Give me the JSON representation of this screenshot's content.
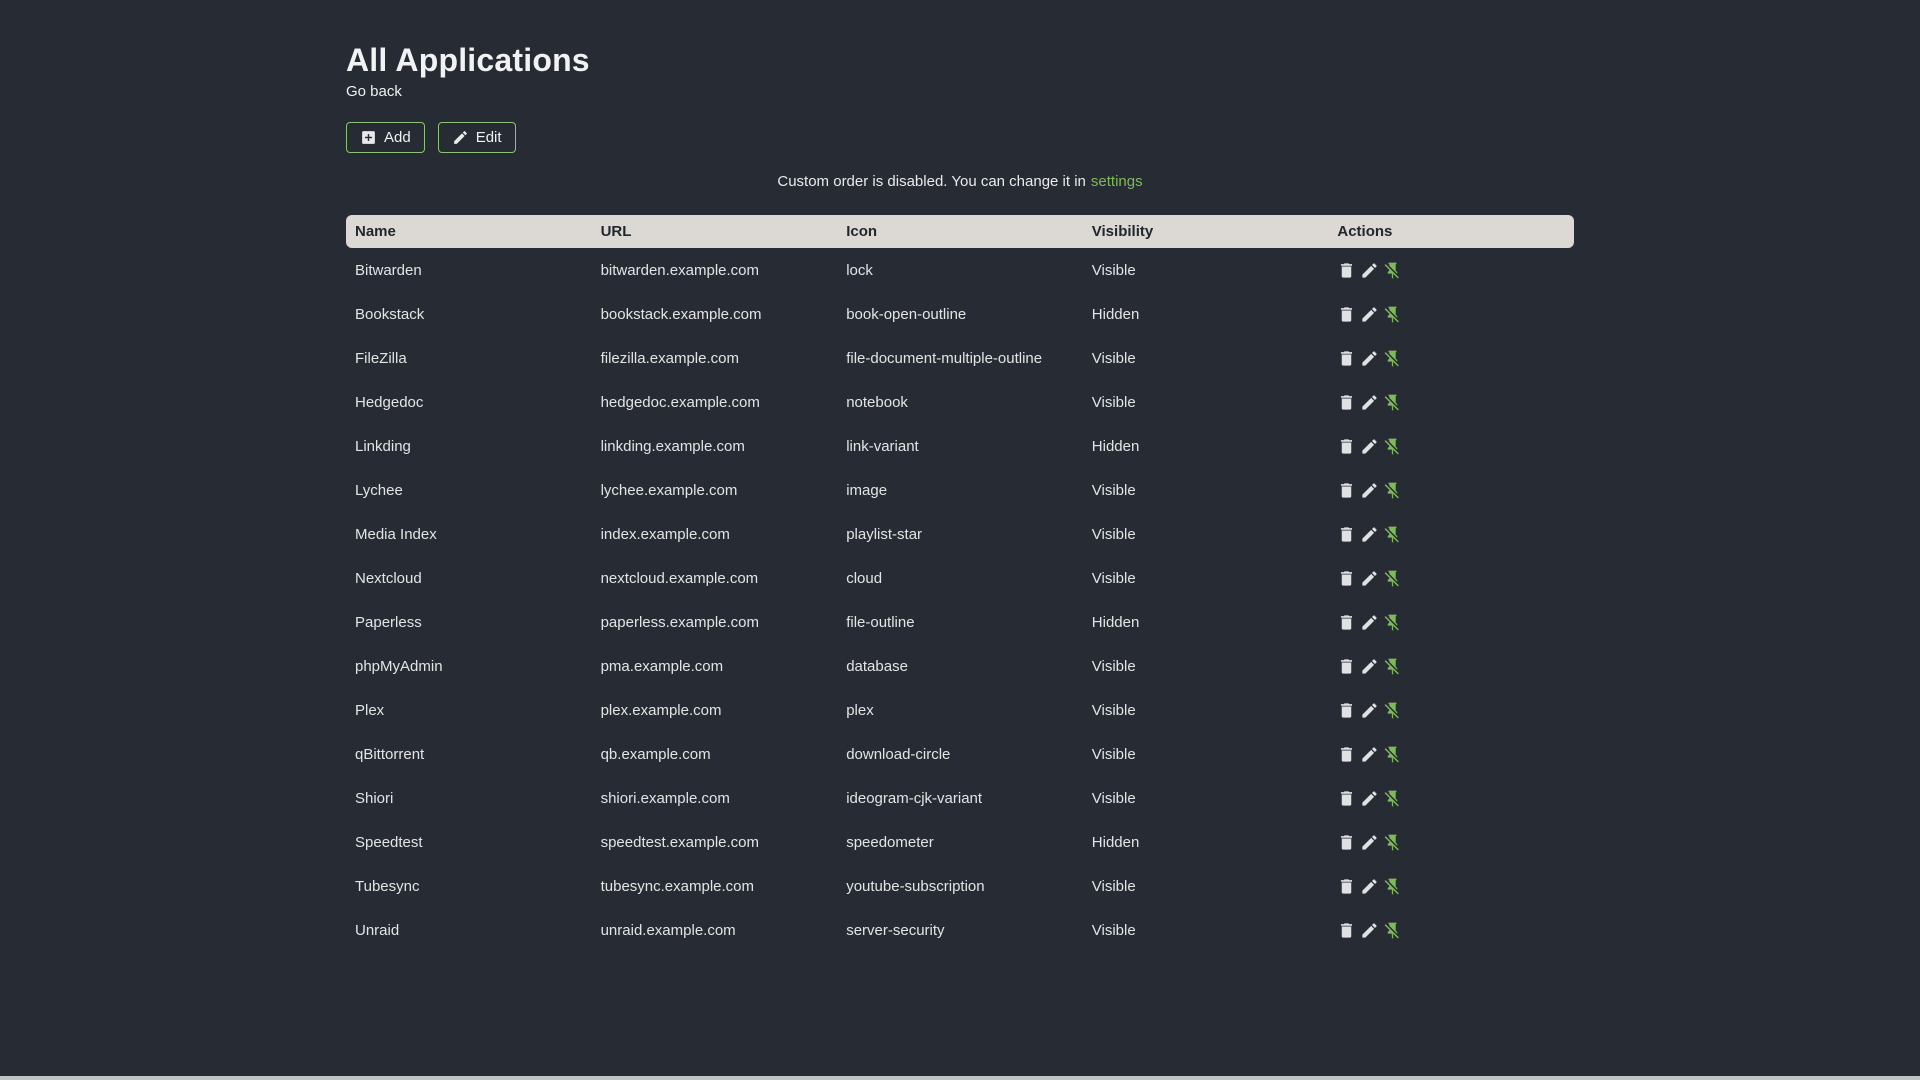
{
  "header": {
    "title": "All Applications",
    "back_label": "Go back"
  },
  "toolbar": {
    "add_label": "Add",
    "edit_label": "Edit"
  },
  "notice": {
    "text": "Custom order is disabled. You can change it in",
    "link_label": "settings"
  },
  "table": {
    "headers": [
      "Name",
      "URL",
      "Icon",
      "Visibility",
      "Actions"
    ],
    "action_icons": [
      "delete",
      "edit",
      "pin-off"
    ],
    "rows": [
      {
        "name": "Bitwarden",
        "url": "bitwarden.example.com",
        "icon": "lock",
        "visibility": "Visible"
      },
      {
        "name": "Bookstack",
        "url": "bookstack.example.com",
        "icon": "book-open-outline",
        "visibility": "Hidden"
      },
      {
        "name": "FileZilla",
        "url": "filezilla.example.com",
        "icon": "file-document-multiple-outline",
        "visibility": "Visible"
      },
      {
        "name": "Hedgedoc",
        "url": "hedgedoc.example.com",
        "icon": "notebook",
        "visibility": "Visible"
      },
      {
        "name": "Linkding",
        "url": "linkding.example.com",
        "icon": "link-variant",
        "visibility": "Hidden"
      },
      {
        "name": "Lychee",
        "url": "lychee.example.com",
        "icon": "image",
        "visibility": "Visible"
      },
      {
        "name": "Media Index",
        "url": "index.example.com",
        "icon": "playlist-star",
        "visibility": "Visible"
      },
      {
        "name": "Nextcloud",
        "url": "nextcloud.example.com",
        "icon": "cloud",
        "visibility": "Visible"
      },
      {
        "name": "Paperless",
        "url": "paperless.example.com",
        "icon": "file-outline",
        "visibility": "Hidden"
      },
      {
        "name": "phpMyAdmin",
        "url": "pma.example.com",
        "icon": "database",
        "visibility": "Visible"
      },
      {
        "name": "Plex",
        "url": "plex.example.com",
        "icon": "plex",
        "visibility": "Visible"
      },
      {
        "name": "qBittorrent",
        "url": "qb.example.com",
        "icon": "download-circle",
        "visibility": "Visible"
      },
      {
        "name": "Shiori",
        "url": "shiori.example.com",
        "icon": "ideogram-cjk-variant",
        "visibility": "Visible"
      },
      {
        "name": "Speedtest",
        "url": "speedtest.example.com",
        "icon": "speedometer",
        "visibility": "Hidden"
      },
      {
        "name": "Tubesync",
        "url": "tubesync.example.com",
        "icon": "youtube-subscription",
        "visibility": "Visible"
      },
      {
        "name": "Unraid",
        "url": "unraid.example.com",
        "icon": "server-security",
        "visibility": "Visible"
      }
    ]
  },
  "colors": {
    "background": "#272B33",
    "accent_green": "#7EBA5B",
    "button_border": "#8CC374",
    "table_header_bg": "#DCD9D4",
    "table_header_text": "#22262D",
    "body_text": "#E9EAEC",
    "icon_gray": "#DFE1E2"
  }
}
